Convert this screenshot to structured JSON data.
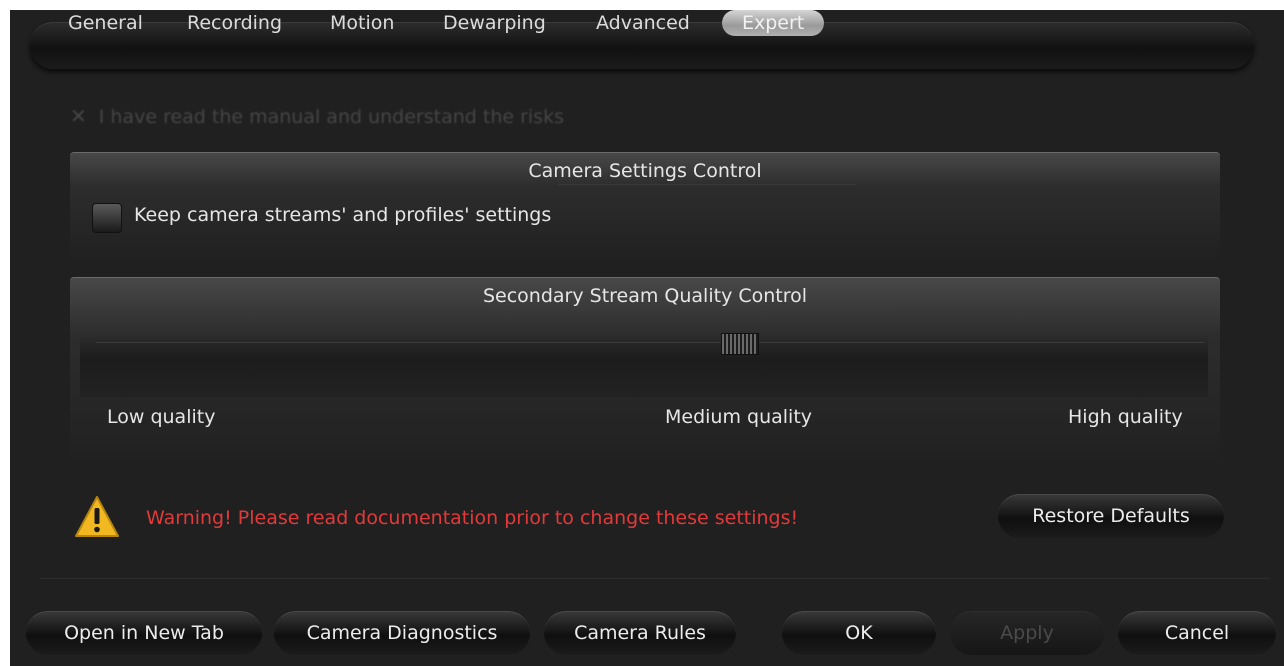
{
  "tabs": [
    {
      "label": "General",
      "active": false
    },
    {
      "label": "Recording",
      "active": false
    },
    {
      "label": "Motion",
      "active": false
    },
    {
      "label": "Dewarping",
      "active": false
    },
    {
      "label": "Advanced",
      "active": false
    },
    {
      "label": "Expert",
      "active": true
    }
  ],
  "risk_ack": {
    "label": "I have read the manual and understand the risks",
    "checked": false
  },
  "camera_settings": {
    "title": "Camera Settings Control",
    "keep_settings_label": "Keep camera streams' and profiles' settings",
    "keep_settings_checked": false
  },
  "secondary_stream": {
    "title": "Secondary Stream Quality Control",
    "slider_position_percent": 58,
    "low_label": "Low quality",
    "medium_label": "Medium quality",
    "high_label": "High quality"
  },
  "warning": {
    "text": "Warning! Please read documentation prior to change these settings!"
  },
  "restore_defaults_label": "Restore Defaults",
  "footer": {
    "open_new_tab": "Open in New Tab",
    "camera_diagnostics": "Camera Diagnostics",
    "camera_rules": "Camera Rules",
    "ok": "OK",
    "apply": "Apply",
    "cancel": "Cancel"
  },
  "colors": {
    "warning_text": "#e23a3a",
    "warning_icon": "#f2b822",
    "background": "#202020"
  }
}
